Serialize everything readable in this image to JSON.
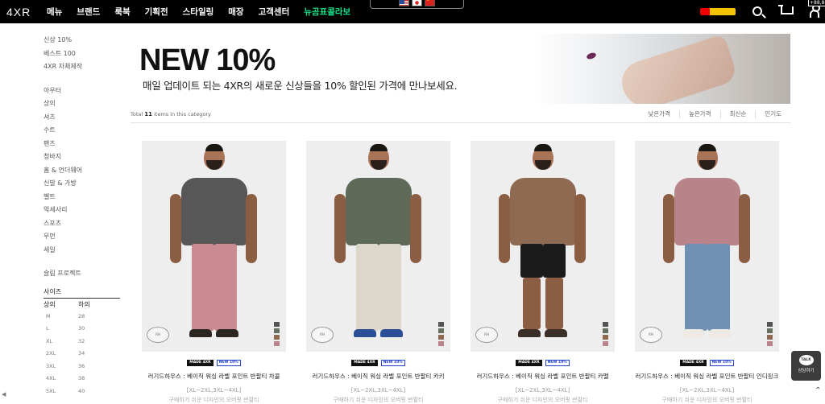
{
  "header": {
    "logo": "4XR",
    "nav": [
      "메뉴",
      "브랜드",
      "룩북",
      "기획전",
      "스타일링",
      "매장",
      "고객센터",
      "뉴곰표콜라보"
    ],
    "languages": [
      "us-flag-icon",
      "jp-flag-icon",
      "cn-flag-icon"
    ],
    "user_badge": "+88,88"
  },
  "sidebar": {
    "top_links": [
      "신상 10%",
      "베스트 100",
      "4XR 자체제작"
    ],
    "categories": [
      "아우터",
      "상의",
      "셔츠",
      "수트",
      "팬츠",
      "청바지",
      "홈 & 언더웨어",
      "신발 & 가방",
      "벨트",
      "악세사리",
      "스포츠",
      "우먼",
      "세일"
    ],
    "special": "슬림 프로젝트",
    "size": {
      "title": "사이즈",
      "headers": [
        "상의",
        "하의"
      ],
      "rows": [
        [
          "M",
          "28"
        ],
        [
          "L",
          "30"
        ],
        [
          "XL",
          "32"
        ],
        [
          "2XL",
          "34"
        ],
        [
          "3XL",
          "36"
        ],
        [
          "4XL",
          "38"
        ],
        [
          "5XL",
          "40"
        ]
      ]
    }
  },
  "banner": {
    "title": "NEW 10%",
    "subtitle": "매일 업데이트 되는 4XR의 새로운 신상들을 10% 할인된 가격에 만나보세요."
  },
  "listing": {
    "total_prefix": "Total",
    "total_count": "11",
    "total_suffix": "items in this category",
    "sorts": [
      "낮은가격",
      "높은가격",
      "최신순",
      "인기도"
    ]
  },
  "products": [
    {
      "tag_made": "MADE 4XR",
      "tag_new": "NEW 10%",
      "name": "러기드하우스 : 베이직 워싱 라벨 포인트 반팔티 차콜",
      "size": "[XL~2XL,3XL~4XL]",
      "desc": "구매하기 쉬운 디자인의 오버핏 반팔티",
      "shirt": "#575757",
      "pants": "#c98a90",
      "shoe": "#2b2622"
    },
    {
      "tag_made": "MADE 4XR",
      "tag_new": "NEW 10%",
      "name": "러기드하우스 : 베이직 워싱 라벨 포인트 반팔티 카키",
      "size": "[XL~2XL,3XL~4XL]",
      "desc": "구매하기 쉬운 디자인의 오버핏 반팔티",
      "shirt": "#5e6a57",
      "pants": "#ddd7ca",
      "shoe": "#2b4f96"
    },
    {
      "tag_made": "MADE 4XR",
      "tag_new": "NEW 10%",
      "name": "러기드하우스 : 베이직 워싱 라벨 포인트 반팔티 카멜",
      "size": "[XL~2XL,3XL~4XL]",
      "desc": "구매하기 쉬운 디자인의 오버핏 반팔티",
      "shirt": "#8f6a52",
      "pants": "#1b1b1b",
      "shoe": "#3a2e26"
    },
    {
      "tag_made": "MADE 4XR",
      "tag_new": "NEW 10%",
      "name": "러기드하우스 : 베이직 워싱 라벨 포인트 반팔티 인디핑크",
      "size": "[XL~2XL,3XL~4XL]",
      "desc": "구매하기 쉬운 디자인의 오버핏 반팔티",
      "shirt": "#b9838a",
      "pants": "#6f8fb3",
      "shoe": "#eeeae3"
    }
  ],
  "swatch_colors": [
    "#555555",
    "#66705e",
    "#8f6a52",
    "#b9838a"
  ],
  "floating": {
    "talk_label": "TALK",
    "talk_text": "상담하기",
    "top_icon": "arrow-up-icon"
  }
}
